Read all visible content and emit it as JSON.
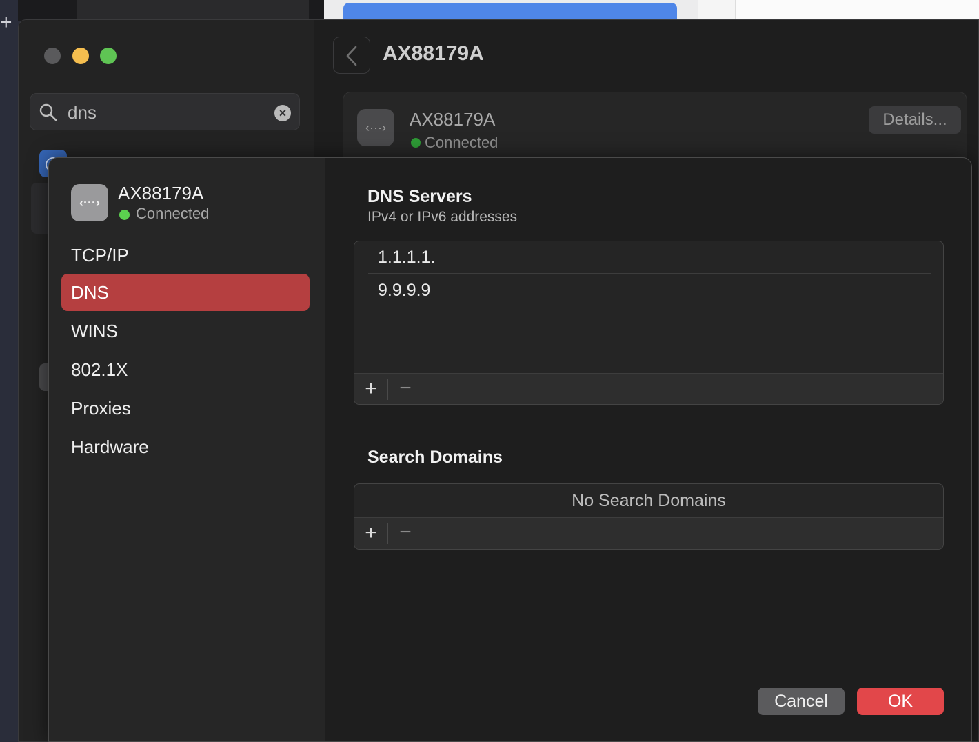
{
  "desktop": {
    "add_glyph": "+"
  },
  "background_window": {
    "search": {
      "value": "dns"
    },
    "header_title": "AX88179A",
    "card": {
      "name": "AX88179A",
      "status": "Connected",
      "details_label": "Details..."
    }
  },
  "sheet": {
    "interface": {
      "name": "AX88179A",
      "status": "Connected",
      "icon_glyph": "‹···›"
    },
    "nav": [
      {
        "label": "TCP/IP",
        "selected": false
      },
      {
        "label": "DNS",
        "selected": true
      },
      {
        "label": "WINS",
        "selected": false
      },
      {
        "label": "802.1X",
        "selected": false
      },
      {
        "label": "Proxies",
        "selected": false
      },
      {
        "label": "Hardware",
        "selected": false
      }
    ],
    "dns_servers": {
      "title": "DNS Servers",
      "subtitle": "IPv4 or IPv6 addresses",
      "entries": [
        "1.1.1.1.",
        "9.9.9.9"
      ]
    },
    "search_domains": {
      "title": "Search Domains",
      "empty_text": "No Search Domains"
    },
    "toolbar": {
      "add": "+",
      "remove": "−"
    },
    "buttons": {
      "cancel": "Cancel",
      "ok": "OK"
    }
  },
  "colors": {
    "accent_selected": "#b53f40",
    "ok_button": "#e2474a",
    "status_connected": "#5bd04f"
  }
}
